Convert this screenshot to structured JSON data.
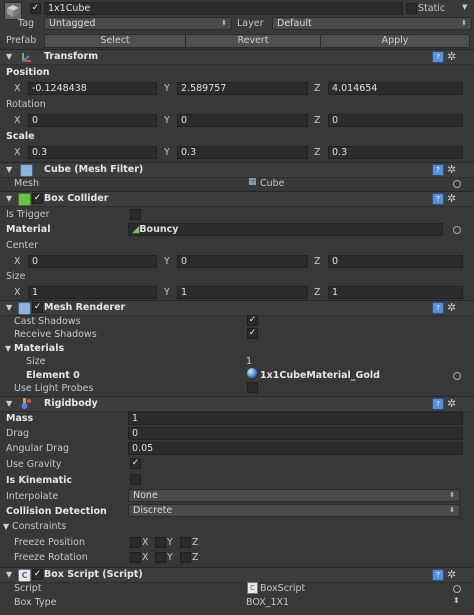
{
  "object": {
    "name": "1x1Cube",
    "static_label": "Static",
    "tag_label": "Tag",
    "tag_value": "Untagged",
    "layer_label": "Layer",
    "layer_value": "Default",
    "prefab_label": "Prefab",
    "select_label": "Select",
    "revert_label": "Revert",
    "apply_label": "Apply"
  },
  "transform": {
    "title": "Transform",
    "position_label": "Position",
    "rotation_label": "Rotation",
    "scale_label": "Scale",
    "x": "X",
    "y": "Y",
    "z": "Z",
    "position": [
      "-0.1248438",
      "2.589757",
      "4.014654"
    ],
    "rotation": [
      "0",
      "0",
      "0"
    ],
    "scale": [
      "0.3",
      "0.3",
      "0.3"
    ]
  },
  "mesh_filter": {
    "title": "Cube (Mesh Filter)",
    "mesh_label": "Mesh",
    "mesh_value": "Cube"
  },
  "box_collider": {
    "title": "Box Collider",
    "is_trigger_label": "Is Trigger",
    "material_label": "Material",
    "material_value": "Bouncy",
    "center_label": "Center",
    "size_label": "Size",
    "center": [
      "0",
      "0",
      "0"
    ],
    "size": [
      "1",
      "1",
      "1"
    ]
  },
  "mesh_renderer": {
    "title": "Mesh Renderer",
    "cast_shadows_label": "Cast Shadows",
    "receive_shadows_label": "Receive Shadows",
    "materials_label": "Materials",
    "size_label": "Size",
    "size_value": "1",
    "element0_label": "Element 0",
    "element0_value": "1x1CubeMaterial_Gold",
    "light_probes_label": "Use Light Probes"
  },
  "rigidbody": {
    "title": "Rigidbody",
    "mass_label": "Mass",
    "mass_value": "1",
    "drag_label": "Drag",
    "drag_value": "0",
    "angular_drag_label": "Angular Drag",
    "angular_drag_value": "0.05",
    "use_gravity_label": "Use Gravity",
    "is_kinematic_label": "Is Kinematic",
    "interpolate_label": "Interpolate",
    "interpolate_value": "None",
    "collision_label": "Collision Detection",
    "collision_value": "Discrete",
    "constraints_label": "Constraints",
    "freeze_position_label": "Freeze Position",
    "freeze_rotation_label": "Freeze Rotation",
    "axes": [
      "X",
      "Y",
      "Z"
    ]
  },
  "box_script": {
    "title": "Box Script (Script)",
    "script_label": "Script",
    "script_value": "BoxScript",
    "box_type_label": "Box Type",
    "box_type_value": "BOX_1X1"
  },
  "colors": {
    "background": "#383838",
    "header": "#3d3d3d",
    "field": "#2c2c2c",
    "help_icon": "#5b8fd6"
  },
  "icons": [
    "cube-icon",
    "transform-axes-icon",
    "mesh-filter-icon",
    "box-collider-icon",
    "mesh-renderer-icon",
    "rigidbody-icon",
    "script-icon",
    "help-icon",
    "gear-icon",
    "sphere-material-icon"
  ]
}
